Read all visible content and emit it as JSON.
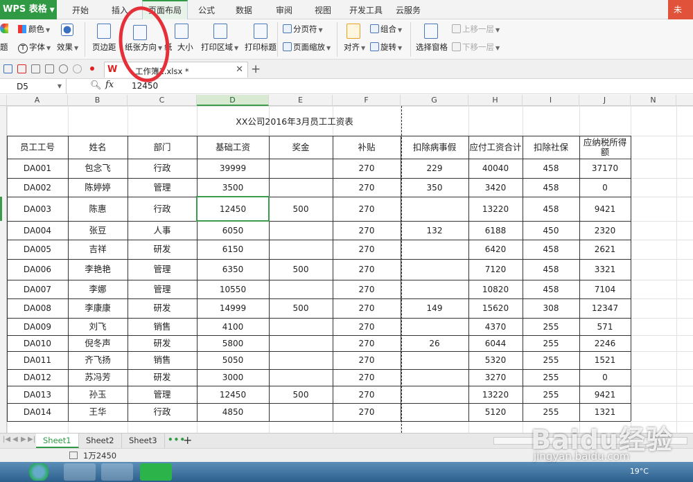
{
  "app": {
    "label": "WPS 表格"
  },
  "menu": {
    "tabs": [
      "开始",
      "插入",
      "页面布局",
      "公式",
      "数据",
      "审阅",
      "视图",
      "开发工具",
      "云服务"
    ],
    "corner": "未"
  },
  "ribbon": {
    "theme_col": {
      "top": "题",
      "bottom": "题"
    },
    "color": "颜色",
    "font": "字体",
    "effect": "效果",
    "margins": "页边距",
    "orientation": "纸张方向",
    "paper_size_partial": "纸",
    "size_partial": "大小",
    "print_area": "打印区域",
    "print_titles": "打印标题",
    "page_break": "分页符",
    "page_zoom": "页面缩放",
    "align": "对齐",
    "group": "组合",
    "rotate": "旋转",
    "select_pane": "选择窗格",
    "bring_forward": "上移一层",
    "send_backward": "下移一层"
  },
  "doc_tab": {
    "logo": "W",
    "name": "工作簿1.xlsx *"
  },
  "formula_bar": {
    "name_box": "D5",
    "fx": "fx",
    "value": "12450"
  },
  "columns": [
    "A",
    "B",
    "C",
    "D",
    "E",
    "F",
    "G",
    "H",
    "I",
    "J",
    "N"
  ],
  "sheet": {
    "title": "XX公司2016年3月员工工资表",
    "headers": [
      "员工工号",
      "姓名",
      "部门",
      "基础工资",
      "奖金",
      "补贴",
      "扣除病事假",
      "应付工资合计",
      "扣除社保",
      "应纳税所得额"
    ],
    "rows": [
      [
        "DA001",
        "包念飞",
        "行政",
        "39999",
        "",
        "270",
        "229",
        "40040",
        "458",
        "37170"
      ],
      [
        "DA002",
        "陈婷婷",
        "管理",
        "3500",
        "",
        "270",
        "350",
        "3420",
        "458",
        "0"
      ],
      [
        "DA003",
        "陈惠",
        "行政",
        "12450",
        "500",
        "270",
        "",
        "13220",
        "458",
        "9421"
      ],
      [
        "DA004",
        "张豆",
        "人事",
        "6050",
        "",
        "270",
        "132",
        "6188",
        "450",
        "2320"
      ],
      [
        "DA005",
        "吉祥",
        "研发",
        "6150",
        "",
        "270",
        "",
        "6420",
        "458",
        "2621"
      ],
      [
        "DA006",
        "李艳艳",
        "管理",
        "6350",
        "500",
        "270",
        "",
        "7120",
        "458",
        "3321"
      ],
      [
        "DA007",
        "李娜",
        "管理",
        "10550",
        "",
        "270",
        "",
        "10820",
        "458",
        "7104"
      ],
      [
        "DA008",
        "李康康",
        "研发",
        "14999",
        "500",
        "270",
        "149",
        "15620",
        "308",
        "12347"
      ],
      [
        "DA009",
        "刘飞",
        "销售",
        "4100",
        "",
        "270",
        "",
        "4370",
        "255",
        "571"
      ],
      [
        "DA010",
        "倪冬声",
        "研发",
        "5800",
        "",
        "270",
        "26",
        "6044",
        "255",
        "2246"
      ],
      [
        "DA011",
        "齐飞扬",
        "销售",
        "5050",
        "",
        "270",
        "",
        "5320",
        "255",
        "1521"
      ],
      [
        "DA012",
        "苏冯芳",
        "研发",
        "3000",
        "",
        "270",
        "",
        "3270",
        "255",
        "0"
      ],
      [
        "DA013",
        "孙玉",
        "管理",
        "12450",
        "500",
        "270",
        "",
        "13220",
        "255",
        "9421"
      ],
      [
        "DA014",
        "王华",
        "行政",
        "4850",
        "",
        "270",
        "",
        "5120",
        "255",
        "1321"
      ]
    ]
  },
  "sheet_tabs": [
    "Sheet1",
    "Sheet2",
    "Sheet3"
  ],
  "sheet_more": "•••",
  "sheet_add": "+",
  "status": {
    "sum": "1万2450"
  },
  "taskbar": {
    "temp": "19°C"
  },
  "watermark": {
    "brand": "Baidu经验",
    "url": "jingyan.baidu.com"
  },
  "colors": {
    "accent": "#2f9a43",
    "annotation": "#e5303a",
    "corner": "#e0533a"
  }
}
